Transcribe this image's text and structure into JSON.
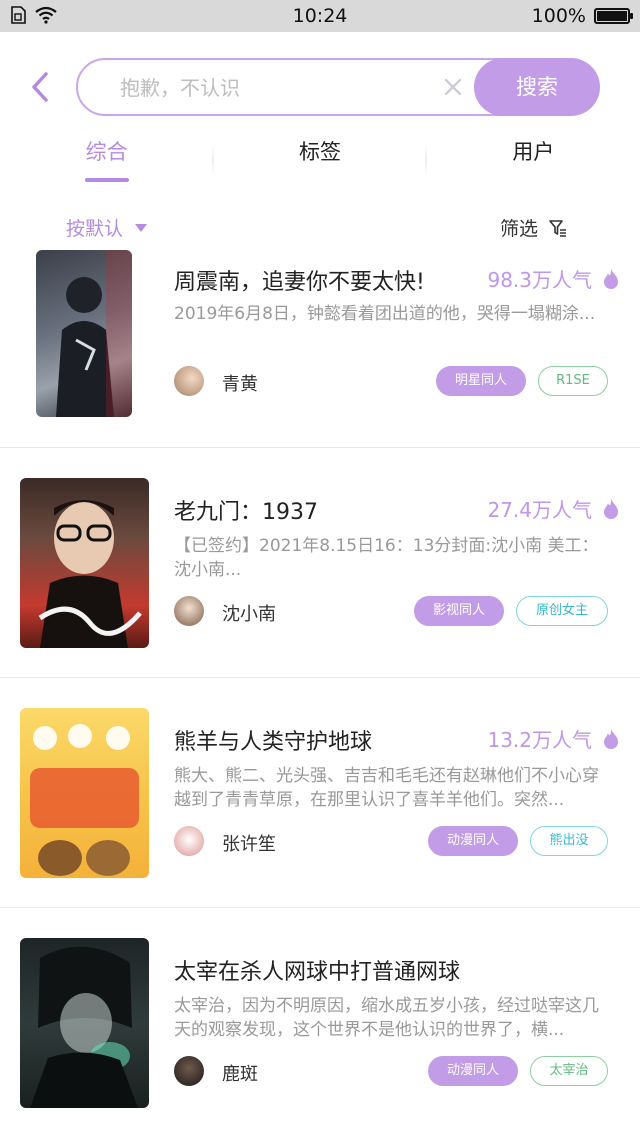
{
  "status": {
    "time": "10:24",
    "battery": "100%"
  },
  "search": {
    "placeholder": "抱歉，不认识",
    "button": "搜索"
  },
  "tabs": [
    {
      "label": "综合",
      "active": true
    },
    {
      "label": "标签",
      "active": false
    },
    {
      "label": "用户",
      "active": false
    }
  ],
  "sort": {
    "label": "按默认"
  },
  "filter": {
    "label": "筛选"
  },
  "accent": "#c29ce6",
  "results": [
    {
      "title": "周震南，追妻你不要太快!",
      "popularity": "98.3万人气",
      "desc": "2019年6月8日，钟懿看着团出道的他，哭得一塌糊涂...",
      "author": "青黄",
      "tags": [
        {
          "label": "明星同人",
          "style": "filled"
        },
        {
          "label": "R1SE",
          "style": "outline-green"
        }
      ]
    },
    {
      "title": "老九门：1937",
      "popularity": "27.4万人气",
      "desc": "【已签约】2021年8.15日16：13分封面:沈小南 美工：沈小南...",
      "author": "沈小南",
      "tags": [
        {
          "label": "影视同人",
          "style": "filled"
        },
        {
          "label": "原创女主",
          "style": "outline-cyan"
        }
      ]
    },
    {
      "title": "熊羊与人类守护地球",
      "popularity": "13.2万人气",
      "desc": "熊大、熊二、光头强、吉吉和毛毛还有赵琳他们不小心穿越到了青青草原，在那里认识了喜羊羊他们。突然...",
      "author": "张许笙",
      "tags": [
        {
          "label": "动漫同人",
          "style": "filled"
        },
        {
          "label": "熊出没",
          "style": "outline-cyan"
        }
      ]
    },
    {
      "title": "太宰在杀人网球中打普通网球",
      "popularity": "",
      "desc": "太宰治，因为不明原因，缩水成五岁小孩，经过哒宰这几天的观察发现，这个世界不是他认识的世界了，横...",
      "author": "鹿斑",
      "tags": [
        {
          "label": "动漫同人",
          "style": "filled"
        },
        {
          "label": "太宰治",
          "style": "outline-green"
        }
      ]
    }
  ]
}
